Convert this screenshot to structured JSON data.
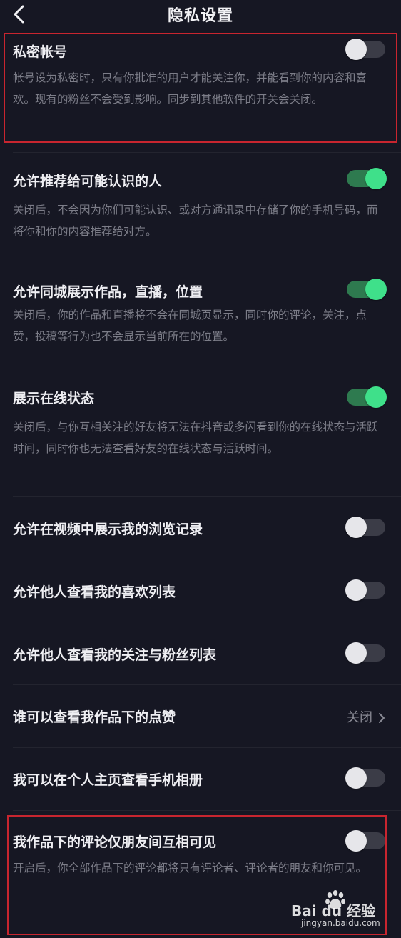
{
  "header": {
    "title": "隐私设置"
  },
  "settings": [
    {
      "title": "私密帐号",
      "desc": "帐号设为私密时，只有你批准的用户才能关注你，并能看到你的内容和喜欢。现有的粉丝不会受到影响。同步到其他软件的开关会关闭。",
      "on": false
    },
    {
      "title": "允许推荐给可能认识的人",
      "desc": "关闭后，不会因为你们可能认识、或对方通讯录中存储了你的手机号码，而将你和你的内容推荐给对方。",
      "on": true
    },
    {
      "title": "允许同城展示作品，直播，位置",
      "desc": "关闭后，你的作品和直播将不会在同城页显示，同时你的评论，关注，点赞，投稿等行为也不会显示当前所在的位置。",
      "on": true
    },
    {
      "title": "展示在线状态",
      "desc": "关闭后，与你互相关注的好友将无法在抖音或多闪看到你的在线状态与活跃时间，同时你也无法查看好友的在线状态与活跃时间。",
      "on": true
    },
    {
      "title": "允许在视频中展示我的浏览记录",
      "on": false
    },
    {
      "title": "允许他人查看我的喜欢列表",
      "on": false
    },
    {
      "title": "允许他人查看我的关注与粉丝列表",
      "on": false
    },
    {
      "title": "谁可以查看我作品下的点赞",
      "value": "关闭"
    },
    {
      "title": "我可以在个人主页查看手机相册",
      "on": false
    },
    {
      "title": "我作品下的评论仅朋友间互相可见",
      "desc": "开启后，你全部作品下的评论都将只有评论者、评论者的朋友和你可见。",
      "on": false
    }
  ],
  "watermark": {
    "brand": "Bai du 经验",
    "url": "jingyan.baidu.com"
  },
  "colors": {
    "background": "#161723",
    "toggle_on": "#3fe08a",
    "highlight": "#c8252f"
  }
}
